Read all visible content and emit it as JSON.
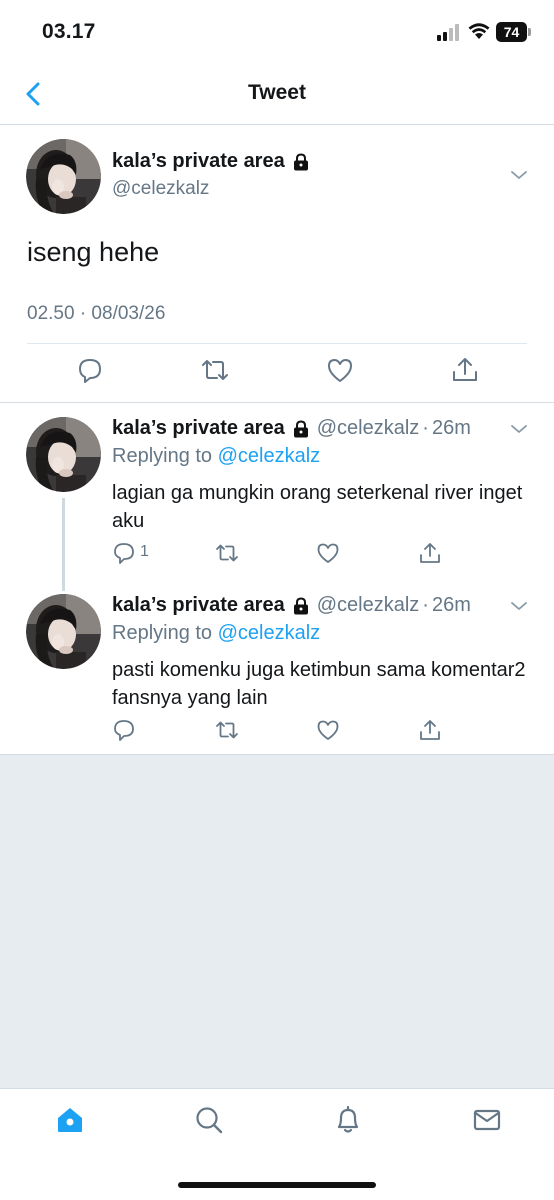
{
  "status_bar": {
    "time": "03.17",
    "battery": "74"
  },
  "nav": {
    "title": "Tweet"
  },
  "main_tweet": {
    "display_name": "kala’s private area",
    "handle": "@celezkalz",
    "text": "iseng hehe",
    "timestamp": "02.50 · 08/03/26",
    "actions": [
      "reply-icon",
      "retweet-icon",
      "like-icon",
      "share-icon"
    ]
  },
  "replies": [
    {
      "display_name": "kala’s private area",
      "handle": "@celezkalz",
      "separator": "·",
      "time": "26m",
      "replying_prefix": "Replying to ",
      "replying_to": "@celezkalz",
      "text": "lagian ga mungkin orang seterkenal river inget aku",
      "reply_count": "1"
    },
    {
      "display_name": "kala’s private area",
      "handle": "@celezkalz",
      "separator": "·",
      "time": "26m",
      "replying_prefix": "Replying to ",
      "replying_to": "@celezkalz",
      "text": "pasti komenku juga ketimbun sama komentar2 fansnya yang lain",
      "reply_count": ""
    }
  ],
  "tab_bar": {
    "tabs": [
      "home-icon",
      "search-icon",
      "notifications-icon",
      "messages-icon"
    ],
    "active_color": "#1da1f2"
  },
  "colors": {
    "accent": "#1da1f2",
    "secondary_text": "#657786",
    "background": "#e6ecf0"
  }
}
